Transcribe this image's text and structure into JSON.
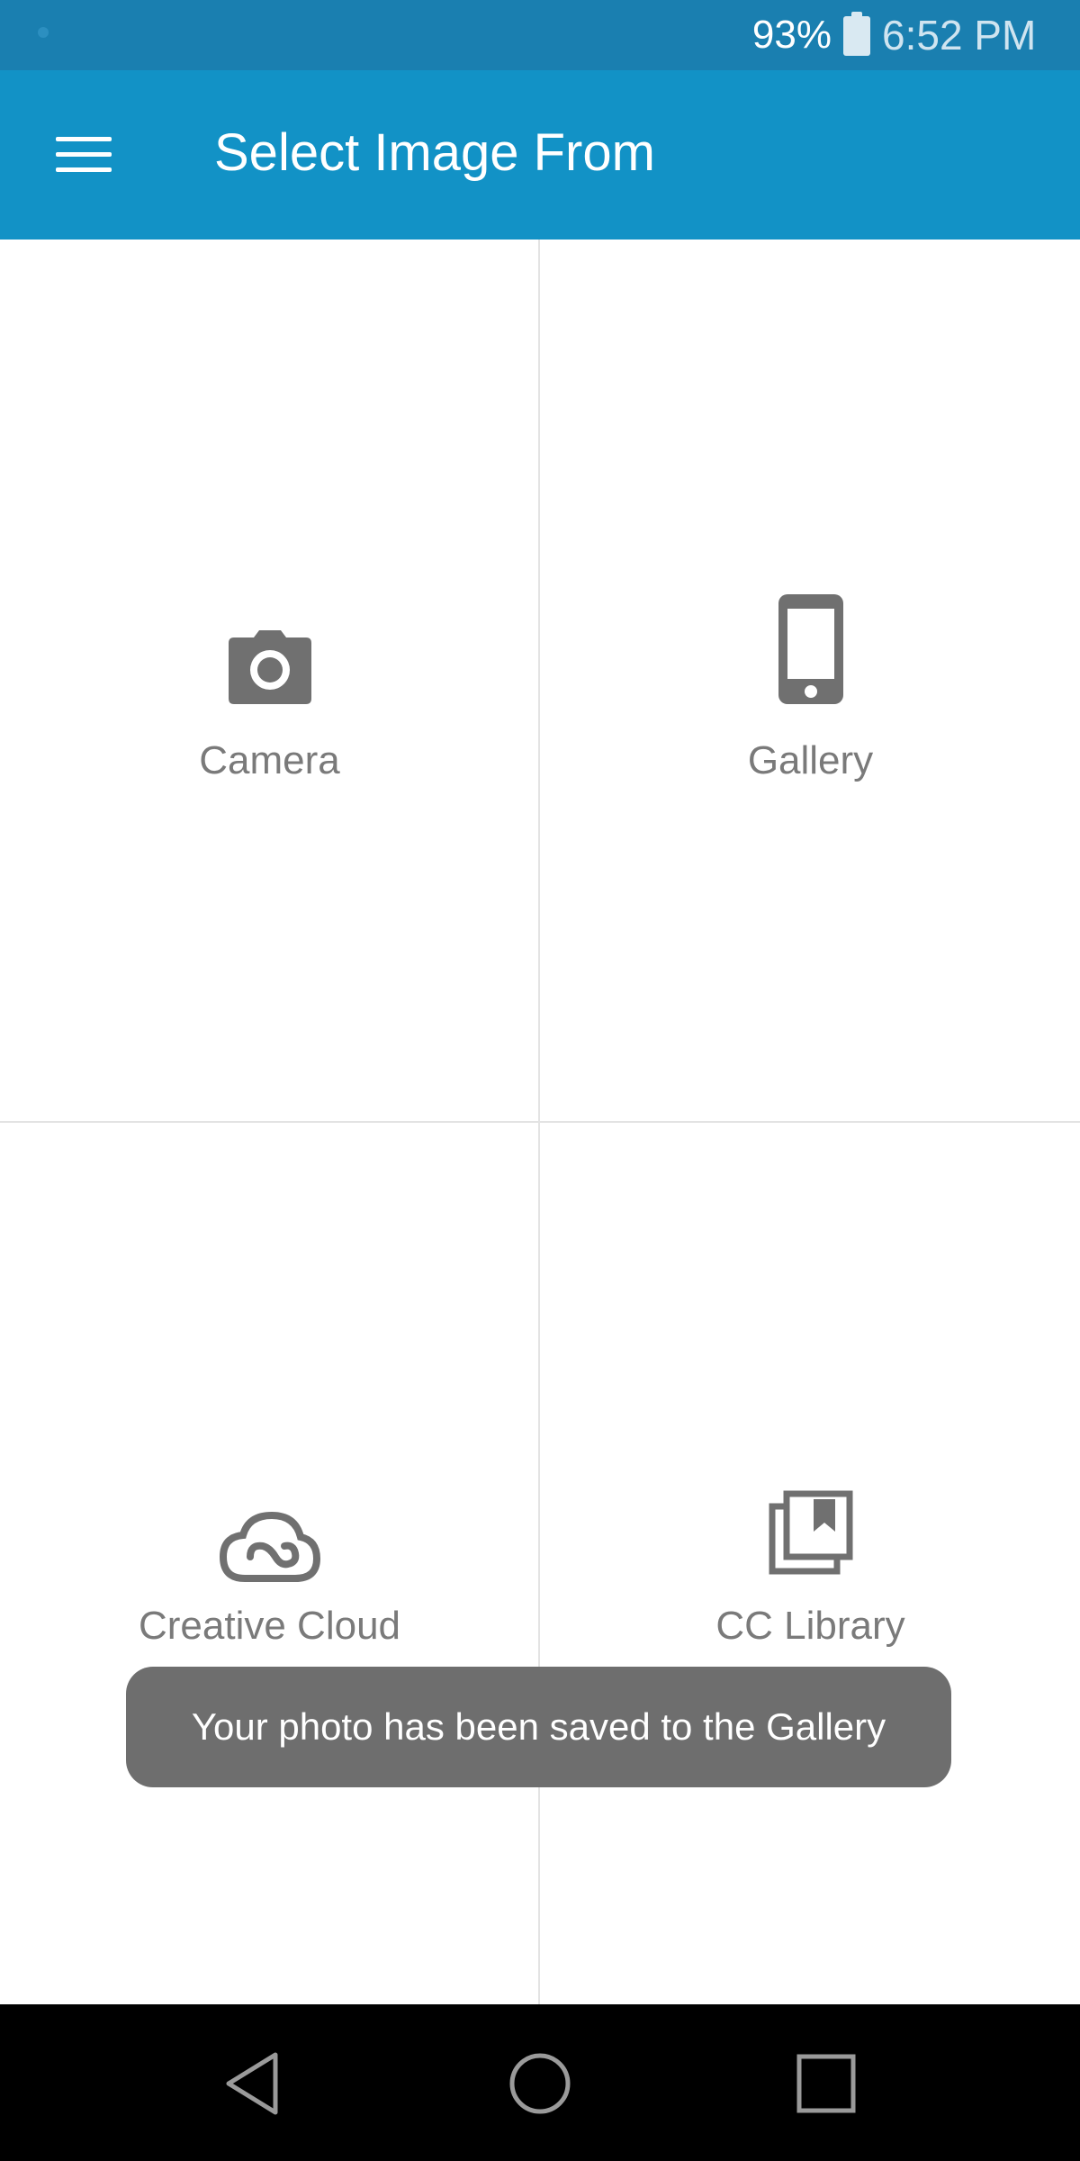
{
  "status_bar": {
    "battery_percent": "93%",
    "time": "6:52 PM",
    "icons": [
      "notification-dot-icon",
      "battery-icon"
    ]
  },
  "app_bar": {
    "title": "Select Image From",
    "menu_icon": "hamburger-menu-icon",
    "color": "#1292c6"
  },
  "sources": [
    {
      "label": "Camera",
      "icon": "camera-icon"
    },
    {
      "label": "Gallery",
      "icon": "phone-icon"
    },
    {
      "label": "Creative Cloud",
      "icon": "creative-cloud-icon"
    },
    {
      "label": "CC Library",
      "icon": "library-icon"
    }
  ],
  "toast": {
    "message": "Your photo has been saved to the Gallery"
  },
  "nav_bar": {
    "icons": [
      "back-icon",
      "home-icon",
      "recents-icon"
    ]
  }
}
